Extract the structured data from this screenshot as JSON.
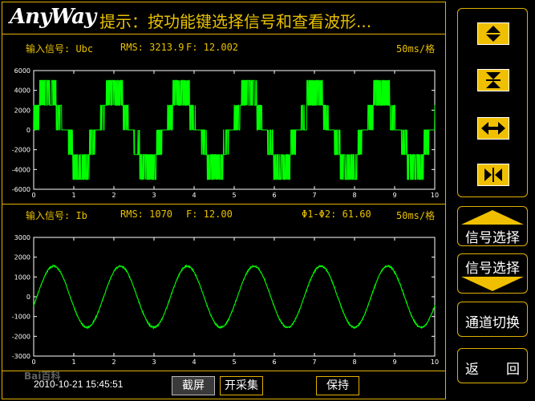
{
  "header": {
    "brand": "AnyWay",
    "prompt": "提示：按功能键选择信号和查看波形..."
  },
  "channel1": {
    "signal_label": "输入信号: Ubc",
    "rms": "RMS: 3213.9",
    "freq": "F: 12.002",
    "timebase": "50ms/格",
    "y_ticks": [
      "6000",
      "4000",
      "2000",
      "0",
      "-2000",
      "-4000",
      "-6000"
    ],
    "x_ticks": [
      "0",
      "1",
      "2",
      "3",
      "4",
      "5",
      "6",
      "7",
      "8",
      "9",
      "10"
    ]
  },
  "channel2": {
    "signal_label": "输入信号: Ib",
    "rms": "RMS: 1070",
    "freq": "F: 12.00",
    "phase": "Φ1-Φ2: 61.60",
    "timebase": "50ms/格",
    "y_ticks": [
      "3000",
      "2000",
      "1000",
      "0",
      "-1000",
      "-2000",
      "-3000"
    ],
    "x_ticks": [
      "0",
      "1",
      "2",
      "3",
      "4",
      "5",
      "6",
      "7",
      "8",
      "9",
      "10"
    ]
  },
  "chart_data": [
    {
      "type": "line",
      "title": "",
      "x_range": [
        0,
        10
      ],
      "ylim": [
        -6000,
        6000
      ],
      "series": [
        {
          "name": "Ubc",
          "waveform": "PWM line voltage",
          "peak": 5000,
          "cycles": 6,
          "frequency": 12.002,
          "rms": 3213.9
        }
      ],
      "color": "#00ff00"
    },
    {
      "type": "line",
      "title": "",
      "x_range": [
        0,
        10
      ],
      "ylim": [
        -3000,
        3000
      ],
      "series": [
        {
          "name": "Ib",
          "waveform": "sine",
          "amplitude": 1550,
          "cycles": 6,
          "frequency": 12.0,
          "rms": 1070
        }
      ],
      "color": "#00ff00"
    }
  ],
  "sidebar": {
    "signal_select_up": "信号选择",
    "signal_select_down": "信号选择",
    "channel_switch": "通道切换",
    "back": "返　　回"
  },
  "footer": {
    "datetime": "2010-10-21 15:45:51",
    "screenshot": "截屏",
    "start_sampling": "开采集",
    "hold": "保持",
    "watermark": "Bai百科"
  }
}
